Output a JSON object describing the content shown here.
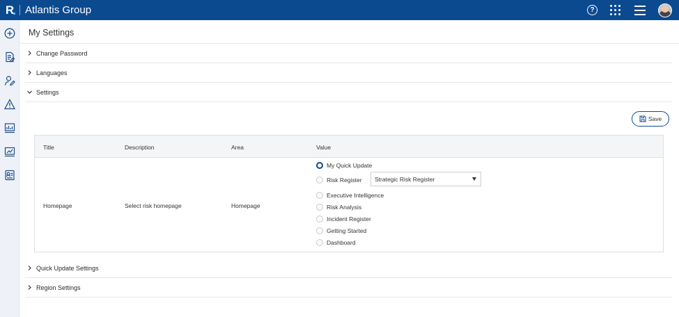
{
  "header": {
    "logo_letter": "R",
    "app_title": "Atlantis Group",
    "help_icon": "help-icon",
    "apps_icon": "apps-grid-icon",
    "menu_icon": "hamburger-menu-icon"
  },
  "colors": {
    "brand": "#0b4a8f",
    "sidebar_bg": "#eef2f8"
  },
  "sidebar": {
    "items": [
      {
        "icon": "add-circle-icon"
      },
      {
        "icon": "document-edit-icon"
      },
      {
        "icon": "user-edit-icon"
      },
      {
        "icon": "warning-icon"
      },
      {
        "icon": "report-chart-icon"
      },
      {
        "icon": "dashboard-chart-icon"
      },
      {
        "icon": "contact-card-icon"
      }
    ]
  },
  "page": {
    "title": "My Settings",
    "sections": [
      {
        "label": "Change Password",
        "expanded": false
      },
      {
        "label": "Languages",
        "expanded": false
      },
      {
        "label": "Settings",
        "expanded": true
      },
      {
        "label": "Quick Update Settings",
        "expanded": false
      },
      {
        "label": "Region Settings",
        "expanded": false
      }
    ],
    "save_label": "Save"
  },
  "table": {
    "headers": {
      "title": "Title",
      "description": "Description",
      "area": "Area",
      "value": "Value"
    },
    "row": {
      "title": "Homepage",
      "description": "Select risk homepage",
      "area": "Homepage",
      "options": [
        {
          "label": "My Quick Update",
          "selected": true
        },
        {
          "label": "Risk Register",
          "selected": false
        },
        {
          "label": "Executive Intelligence",
          "selected": false
        },
        {
          "label": "Risk Analysis",
          "selected": false
        },
        {
          "label": "Incident Register",
          "selected": false
        },
        {
          "label": "Getting Started",
          "selected": false
        },
        {
          "label": "Dashboard",
          "selected": false
        }
      ],
      "risk_register_select": "Strategic Risk Register"
    }
  }
}
